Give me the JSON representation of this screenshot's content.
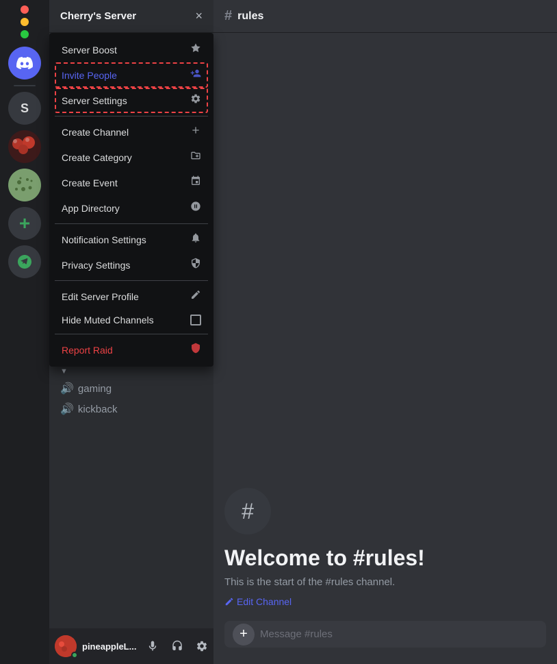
{
  "window": {
    "title": "Cherry's Server",
    "channel": "rules"
  },
  "traffic_lights": {
    "red": "close",
    "yellow": "minimize",
    "green": "maximize"
  },
  "icon_bar": {
    "discord_label": "Discord",
    "server_s_label": "S",
    "add_label": "+",
    "explore_label": "Explore"
  },
  "server_header": {
    "title": "Cherry's Server",
    "close_icon": "×"
  },
  "dropdown": {
    "items": [
      {
        "id": "server-boost",
        "label": "Server Boost",
        "icon": "♡",
        "highlighted": false,
        "color": "normal"
      },
      {
        "id": "invite-people",
        "label": "Invite People",
        "icon": "👤",
        "highlighted": false,
        "color": "invite"
      },
      {
        "id": "server-settings",
        "label": "Server Settings",
        "icon": "⚙",
        "highlighted": true,
        "color": "normal"
      },
      {
        "id": "create-channel",
        "label": "Create Channel",
        "icon": "+",
        "highlighted": false,
        "color": "normal"
      },
      {
        "id": "create-category",
        "label": "Create Category",
        "icon": "📁",
        "highlighted": false,
        "color": "normal"
      },
      {
        "id": "create-event",
        "label": "Create Event",
        "icon": "📅",
        "highlighted": false,
        "color": "normal"
      },
      {
        "id": "app-directory",
        "label": "App Directory",
        "icon": "🏪",
        "highlighted": false,
        "color": "normal"
      },
      {
        "id": "notification-settings",
        "label": "Notification Settings",
        "icon": "🔔",
        "highlighted": false,
        "color": "normal"
      },
      {
        "id": "privacy-settings",
        "label": "Privacy Settings",
        "icon": "🛡",
        "highlighted": false,
        "color": "normal"
      },
      {
        "id": "edit-server-profile",
        "label": "Edit Server Profile",
        "icon": "✏",
        "highlighted": false,
        "color": "normal"
      },
      {
        "id": "hide-muted-channels",
        "label": "Hide Muted Channels",
        "icon": "☐",
        "highlighted": false,
        "color": "normal"
      },
      {
        "id": "report-raid",
        "label": "Report Raid",
        "icon": "🛡",
        "highlighted": false,
        "color": "report"
      }
    ],
    "divider_after": [
      2,
      8,
      10
    ]
  },
  "channels": {
    "voice_channels": [
      {
        "name": "gaming"
      },
      {
        "name": "kickback"
      }
    ]
  },
  "welcome": {
    "icon": "#",
    "title": "Welcome to #rules!",
    "description": "This is the start of the #rules channel.",
    "edit_link": "Edit Channel"
  },
  "message_input": {
    "placeholder": "Message #rules"
  },
  "user": {
    "name": "pineappleL...",
    "avatar_color": "#c0392b"
  }
}
